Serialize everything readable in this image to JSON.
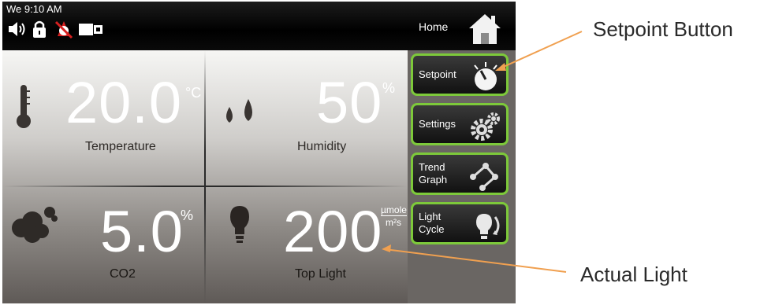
{
  "status": {
    "clock": "We 9:10 AM"
  },
  "header": {
    "home_label": "Home"
  },
  "readings": {
    "temperature": {
      "value": "20.0",
      "unit": "°C",
      "label": "Temperature"
    },
    "humidity": {
      "value": "50",
      "unit": "%",
      "label": "Humidity"
    },
    "co2": {
      "value": "5.0",
      "unit": "%",
      "label": "CO2"
    },
    "light": {
      "value": "200",
      "unit_top": "µmole",
      "unit_bottom": "m²s",
      "label": "Top Light"
    }
  },
  "side_buttons": [
    {
      "label": "Setpoint",
      "icon": "setpoint-dial-icon"
    },
    {
      "label": "Settings",
      "icon": "gears-icon"
    },
    {
      "label": "Trend\nGraph",
      "icon": "trend-graph-icon"
    },
    {
      "label": "Light\nCycle",
      "icon": "light-cycle-icon"
    }
  ],
  "callouts": {
    "setpoint": "Setpoint Button",
    "light": "Actual Light"
  },
  "colors": {
    "button_border": "#7dc93a",
    "callout_arrow": "#f0a050",
    "topbar": "#000000"
  }
}
